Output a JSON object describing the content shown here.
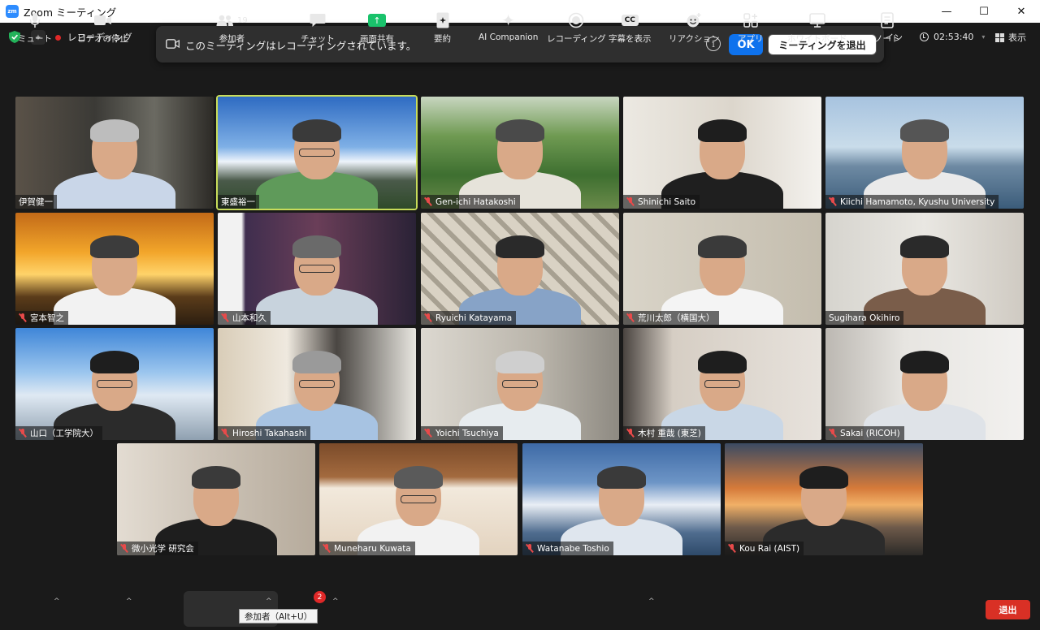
{
  "window": {
    "app_icon": "zm",
    "title": "Zoom ミーティング",
    "controls": [
      "—",
      "☐",
      "✕"
    ]
  },
  "topbar": {
    "recording_label": "レコーディング",
    "cut_off_text": "イン",
    "timer": "02:53:40",
    "view_label": "表示"
  },
  "banner": {
    "message": "このミーティングはレコーディングされています。",
    "info_glyph": "i",
    "ok_label": "OK",
    "leave_label": "ミーティングを退出"
  },
  "tiles": [
    {
      "name": "伊賀健一",
      "muted": false,
      "active": false
    },
    {
      "name": "東盛裕一",
      "muted": false,
      "active": true
    },
    {
      "name": "Gen-ichi Hatakoshi",
      "muted": true,
      "active": false
    },
    {
      "name": "Shinichi Saito",
      "muted": true,
      "active": false
    },
    {
      "name": "Kiichi Hamamoto, Kyushu University",
      "muted": true,
      "active": false
    },
    {
      "name": "宮本智之",
      "muted": true,
      "active": false
    },
    {
      "name": "山本和久",
      "muted": true,
      "active": false
    },
    {
      "name": "Ryuichi Katayama",
      "muted": true,
      "active": false
    },
    {
      "name": "荒川太郎（横国大）",
      "muted": true,
      "active": false
    },
    {
      "name": "Sugihara Okihiro",
      "muted": false,
      "active": false
    },
    {
      "name": "山口（工学院大）",
      "muted": true,
      "active": false
    },
    {
      "name": "Hiroshi Takahashi",
      "muted": true,
      "active": false
    },
    {
      "name": "Yoichi Tsuchiya",
      "muted": true,
      "active": false
    },
    {
      "name": "木村 重哉 (東芝)",
      "muted": true,
      "active": false
    },
    {
      "name": "Sakai (RICOH)",
      "muted": true,
      "active": false
    },
    {
      "name": "微小光学 研究会",
      "muted": true,
      "active": false
    },
    {
      "name": "Muneharu Kuwata",
      "muted": true,
      "active": false
    },
    {
      "name": "Watanabe Toshio",
      "muted": true,
      "active": false
    },
    {
      "name": "Kou Rai (AIST)",
      "muted": true,
      "active": false
    }
  ],
  "toolbar": {
    "mute": "ミュート",
    "video": "ビデオの停止",
    "participants": "参加者",
    "participants_count": "19",
    "participants_tooltip": "参加者（Alt+U）",
    "chat": "チャット",
    "chat_badge": "2",
    "share": "画面共有",
    "summary": "要約",
    "ai_companion": "AI Companion",
    "recording": "レコーディング",
    "captions": "字幕を表示",
    "reactions": "リアクション",
    "apps": "アプリ",
    "whiteboard": "ホワイトボード",
    "notes": "ノート",
    "end": "退出"
  },
  "colors": {
    "accent_blue": "#0e72ed",
    "end_red": "#d93025",
    "share_green": "#19c26b",
    "active_speaker": "#c8dc5a"
  }
}
